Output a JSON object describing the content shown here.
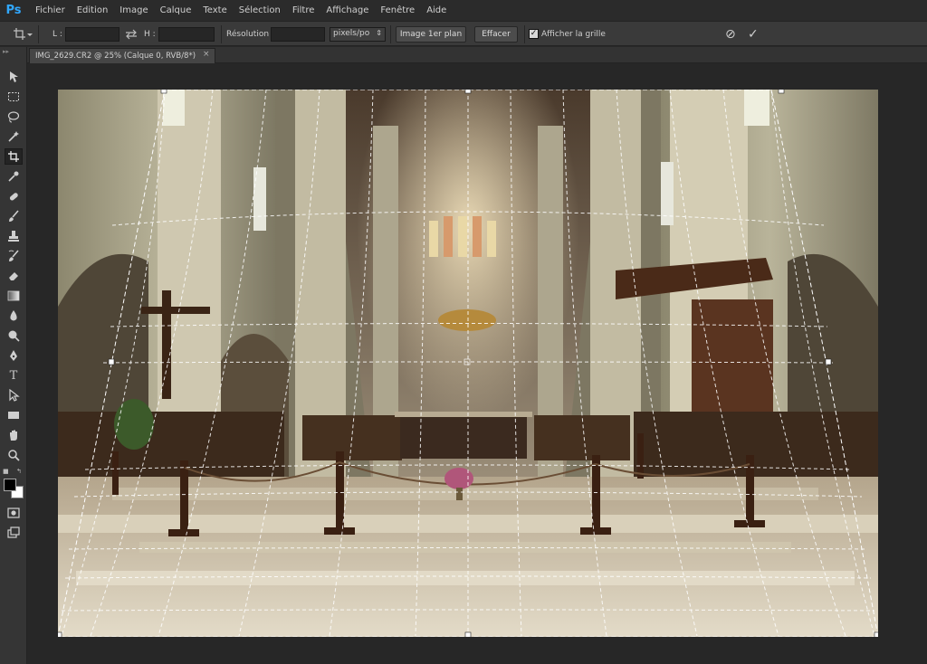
{
  "app": {
    "logo": "Ps"
  },
  "menu": [
    "Fichier",
    "Edition",
    "Image",
    "Calque",
    "Texte",
    "Sélection",
    "Filtre",
    "Affichage",
    "Fenêtre",
    "Aide"
  ],
  "options": {
    "width_label": "L :",
    "width_value": "",
    "height_label": "H :",
    "height_value": "",
    "resolution_label": "Résolution :",
    "resolution_value": "",
    "unit": "pixels/po",
    "front_image_button": "Image 1er plan",
    "clear_button": "Effacer",
    "grid_label": "Afficher la grille",
    "grid_checked": true
  },
  "document": {
    "tab_title": "IMG_2629.CR2 @ 25% (Calque 0, RVB/8*)",
    "close_glyph": "×",
    "zoom": "25%"
  },
  "colors": {
    "accent": "#31a8ff",
    "workspace": "#272727",
    "panel": "#353535",
    "foreground_swatch": "#000000",
    "background_swatch": "#ffffff"
  },
  "tools": [
    "move-icon",
    "marquee-icon",
    "lasso-icon",
    "magic-wand-icon",
    "crop-icon",
    "eyedropper-icon",
    "healing-brush-icon",
    "brush-icon",
    "clone-stamp-icon",
    "history-brush-icon",
    "eraser-icon",
    "gradient-icon",
    "blur-icon",
    "dodge-icon",
    "pen-icon",
    "type-icon",
    "path-selection-icon",
    "rectangle-icon",
    "hand-icon",
    "zoom-icon",
    "quick-mask-icon",
    "screen-mode-icon"
  ]
}
